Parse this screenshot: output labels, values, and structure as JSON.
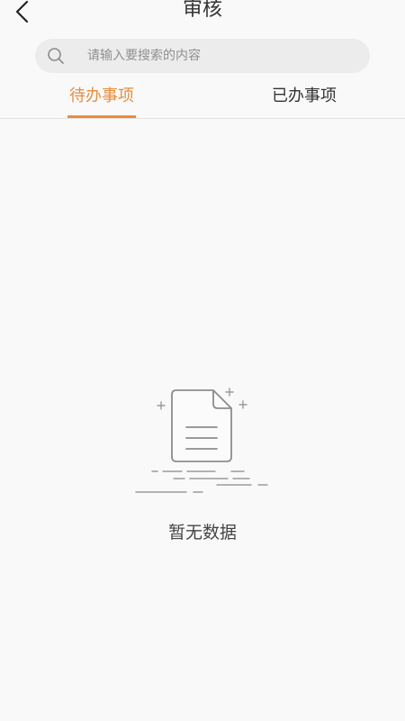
{
  "header": {
    "title": "审核",
    "back_icon": "chevron-left-icon"
  },
  "search": {
    "placeholder": "请输入要搜索的内容",
    "value": "",
    "icon": "search-icon"
  },
  "tabs": [
    {
      "label": "待办事项",
      "active": true
    },
    {
      "label": "已办事项",
      "active": false
    }
  ],
  "empty_state": {
    "icon": "document-icon",
    "message": "暂无数据"
  },
  "colors": {
    "accent": "#e98d3c",
    "background": "#f9f9f9",
    "search_bg": "#ececec",
    "text": "#333333",
    "muted": "#8f8f8f"
  }
}
